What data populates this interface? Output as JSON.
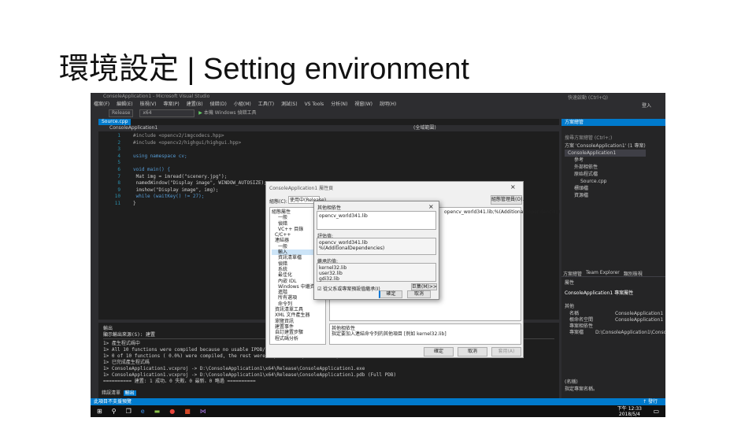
{
  "slide": {
    "title": "環境設定 | Setting environment"
  },
  "vs": {
    "window_title": "ConsoleApplication1 - Microsoft Visual Studio",
    "menu": [
      "檔案(F)",
      "編輯(E)",
      "檢視(V)",
      "專案(P)",
      "建置(B)",
      "偵錯(D)",
      "小組(M)",
      "工具(T)",
      "測試(S)",
      "VS Tools",
      "分析(N)",
      "視窗(W)",
      "說明(H)"
    ],
    "toolbar": {
      "config": "Release",
      "platform": "x64",
      "run": "本機 Windows 偵錯工具"
    },
    "quick_launch": "快速啟動 (Ctrl+Q)",
    "user": "登入",
    "editor": {
      "tab": "Source.cpp",
      "nav_left": "ConsoleApplication1",
      "nav_right": "(全域範圍)",
      "lines": [
        {
          "n": "1",
          "t": "#include <opencv2/imgcodecs.hpp>"
        },
        {
          "n": "2",
          "t": "#include <opencv2/highgui/highgui.hpp>"
        },
        {
          "n": "3",
          "t": ""
        },
        {
          "n": "4",
          "t": "using namespace cv;"
        },
        {
          "n": "5",
          "t": ""
        },
        {
          "n": "6",
          "t": "void main() {"
        },
        {
          "n": "7",
          "t": "    Mat img = imread(\"scenery.jpg\");"
        },
        {
          "n": "8",
          "t": "    namedWindow(\"Display image\", WINDOW_AUTOSIZE);"
        },
        {
          "n": "9",
          "t": "    imshow(\"Display image\", img);"
        },
        {
          "n": "10",
          "t": "    while (waitKey() != 27);"
        },
        {
          "n": "11",
          "t": "}"
        }
      ]
    },
    "output": {
      "label": "輸出",
      "source": "顯示輸出來源(S): 建置",
      "lines": [
        "1>  產生程式碼中",
        "1>  All 10 functions were compiled because no usable IPDB/IOBJ from previous compilation was found.",
        "1>    0 of 10 functions ( 0.0%) were compiled, the rest were copied from previous compilation.",
        "1>  已完成產生程式碼",
        "1>  ConsoleApplication1.vcxproj -> D:\\ConsoleApplication1\\x64\\Release\\ConsoleApplication1.exe",
        "1>  ConsoleApplication1.vcxproj -> D:\\ConsoleApplication1\\x64\\Release\\ConsoleApplication1.pdb (Full PDB)",
        "========== 建置: 1 成功、0 失敗、0 最新、0 略過 =========="
      ],
      "tabs": [
        "錯誤清單",
        "輸出"
      ]
    },
    "status": "此項目不支援預覽",
    "status_right": "↑ 發行",
    "solution_explorer": {
      "title": "方案總管",
      "search": "搜尋方案總管 (Ctrl+;)",
      "items": [
        "方案 'ConsoleApplication1' (1 專案)",
        "ConsoleApplication1",
        "參考",
        "外部相依性",
        "原始程式檔",
        "Source.cpp",
        "標頭檔",
        "資源檔"
      ],
      "tabs": [
        "方案總管",
        "Team Explorer",
        "類別檢視"
      ]
    },
    "properties": {
      "title": "屬性",
      "object": "ConsoleApplication1 專案屬性",
      "category": "其他",
      "rows": [
        [
          "名稱",
          "ConsoleApplication1"
        ],
        [
          "根命名空間",
          "ConsoleApplication1"
        ],
        [
          "專案相依性",
          ""
        ],
        [
          "專案檔",
          "D:\\ConsoleApplication1\\ConsoleApplication1.vcxproj"
        ]
      ],
      "desc_title": "(名稱)",
      "desc": "指定專案名稱。"
    },
    "property_pages": {
      "title": "ConsoleApplication1 屬性頁",
      "config_label": "組態(C):",
      "config": "使用中(Release)",
      "manager": "組態管理員(O)...",
      "tree": [
        "組態屬性",
        "一般",
        "偵錯",
        "VC++ 目錄",
        "C/C++",
        "連結器",
        "一般",
        "輸入",
        "資訊清單檔",
        "偵錯",
        "系統",
        "最佳化",
        "內嵌 IDL",
        "Windows 中繼資料",
        "進階",
        "所有選項",
        "命令列",
        "資訊清單工具",
        "XML 文件產生器",
        "瀏覽資訊",
        "建置事件",
        "自訂建置步驟",
        "程式碼分析"
      ],
      "value": "opencv_world341.lib;%(AdditionalDependencies)",
      "help_title": "其他相依性",
      "help": "指定要加入連結命令列的其他項目 [例如 kernel32.lib]",
      "buttons": [
        "確定",
        "取消",
        "套用(A)"
      ]
    },
    "additional_deps": {
      "title": "其他相依性",
      "input": "opencv_world341.lib",
      "eval_label": "評估值:",
      "eval": [
        "opencv_world341.lib",
        "%(AdditionalDependencies)"
      ],
      "inherit_label": "繼承的值:",
      "inherit": [
        "kernel32.lib",
        "user32.lib",
        "gdi32.lib"
      ],
      "checkbox": "從父系或專案預設值繼承(I)",
      "checked": true,
      "macro": "巨集(M)>>",
      "buttons": [
        "確定",
        "取消"
      ]
    },
    "taskbar": {
      "time": "下午 12:33",
      "date": "2018/5/4"
    }
  }
}
